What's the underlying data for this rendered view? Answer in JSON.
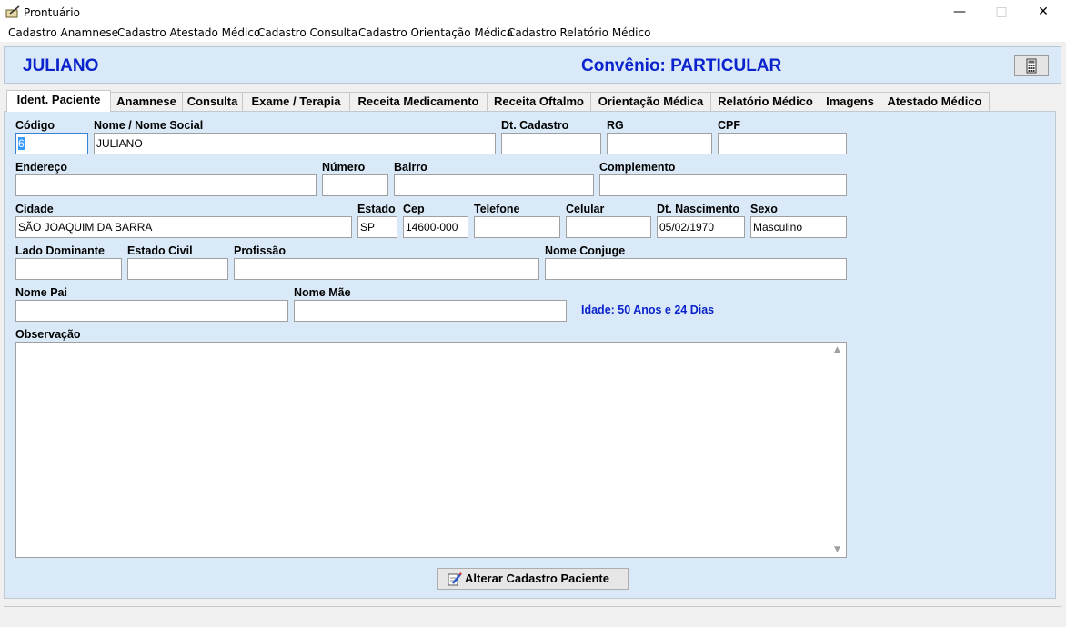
{
  "window": {
    "title": "Prontuário",
    "minimize": "—",
    "maximize": "□",
    "close": "✕"
  },
  "menu": {
    "items": [
      {
        "label": "Cadastro Anamnese"
      },
      {
        "label": "Cadastro Atestado Médico"
      },
      {
        "label": "Cadastro Consulta"
      },
      {
        "label": "Cadastro Orientação Médica"
      },
      {
        "label": "Cadastro Relatório Médico"
      }
    ]
  },
  "header": {
    "patient_name": "JULIANO",
    "convenio": "Convênio: PARTICULAR",
    "calc_icon": "calculator-icon",
    "accent_color": "#0a23cc",
    "panel_color": "#d9e9f7"
  },
  "tabs": [
    {
      "label": "Ident. Paciente",
      "active": true
    },
    {
      "label": "Anamnese"
    },
    {
      "label": "Consulta"
    },
    {
      "label": "Exame / Terapia"
    },
    {
      "label": "Receita Medicamento"
    },
    {
      "label": "Receita Oftalmo"
    },
    {
      "label": "Orientação Médica"
    },
    {
      "label": "Relatório Médico"
    },
    {
      "label": "Imagens"
    },
    {
      "label": "Atestado Médico"
    }
  ],
  "form": {
    "codigo": {
      "label": "Código",
      "value": "6"
    },
    "nome": {
      "label": "Nome / Nome Social",
      "value": "JULIANO"
    },
    "dt_cadastro": {
      "label": "Dt. Cadastro",
      "value": ""
    },
    "rg": {
      "label": "RG",
      "value": ""
    },
    "cpf": {
      "label": "CPF",
      "value": ""
    },
    "endereco": {
      "label": "Endereço",
      "value": ""
    },
    "numero": {
      "label": "Número",
      "value": ""
    },
    "bairro": {
      "label": "Bairro",
      "value": ""
    },
    "complemento": {
      "label": "Complemento",
      "value": ""
    },
    "cidade": {
      "label": "Cidade",
      "value": "SÃO JOAQUIM DA BARRA"
    },
    "estado": {
      "label": "Estado",
      "value": "SP"
    },
    "cep": {
      "label": "Cep",
      "value": "14600-000"
    },
    "telefone": {
      "label": "Telefone",
      "value": ""
    },
    "celular": {
      "label": "Celular",
      "value": ""
    },
    "dt_nascimento": {
      "label": "Dt. Nascimento",
      "value": "05/02/1970"
    },
    "sexo": {
      "label": "Sexo",
      "value": "Masculino"
    },
    "lado_dominante": {
      "label": "Lado Dominante",
      "value": ""
    },
    "estado_civil": {
      "label": "Estado Civil",
      "value": ""
    },
    "profissao": {
      "label": "Profissão",
      "value": ""
    },
    "nome_conjuge": {
      "label": "Nome Conjuge",
      "value": ""
    },
    "nome_pai": {
      "label": "Nome Pai",
      "value": ""
    },
    "nome_mae": {
      "label": "Nome Mãe",
      "value": ""
    },
    "idade": "Idade: 50 Anos e 24 Dias",
    "observacao": {
      "label": "Observação",
      "value": ""
    }
  },
  "actions": {
    "alterar_label": "Alterar Cadastro Paciente",
    "alterar_icon": "edit-pencil-icon"
  }
}
